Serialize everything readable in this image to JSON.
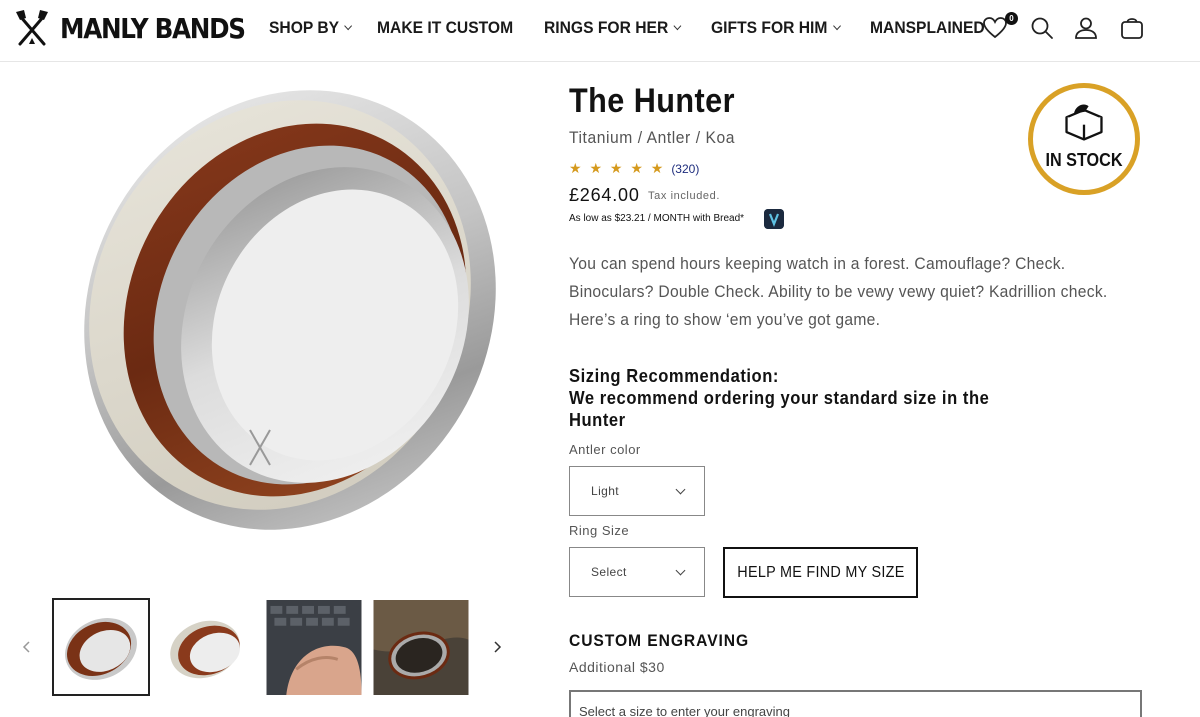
{
  "brand": {
    "name": "MANLY BANDS"
  },
  "nav": {
    "items": [
      {
        "label": "SHOP BY",
        "dropdown": true
      },
      {
        "label": "MAKE IT CUSTOM",
        "dropdown": false
      },
      {
        "label": "RINGS FOR HER",
        "dropdown": true
      },
      {
        "label": "GIFTS FOR HIM",
        "dropdown": true
      },
      {
        "label": "MANSPLAINED",
        "dropdown": false
      }
    ]
  },
  "header_icons": {
    "wishlist_icon": "heart-icon",
    "wishlist_count": "0",
    "search_icon": "search-icon",
    "account_icon": "user-icon",
    "cart_icon": "cart-icon"
  },
  "product": {
    "title": "The Hunter",
    "subtitle": "Titanium / Antler / Koa",
    "stars": "★ ★ ★ ★ ★",
    "rating_value": 5,
    "review_count": "(320)",
    "price": "£264.00",
    "tax_note": "Tax included.",
    "financing": "As low as $23.21 / MONTH with Bread*",
    "stock_badge": "IN STOCK",
    "description": "You can spend hours keeping watch in a forest. Camouflage? Check. Binoculars? Double Check. Ability to be vewy vewy quiet? Kadrillion check. Here’s a ring to show ‘em you’ve got game.",
    "sizing_heading": "Sizing Recommendation:",
    "sizing_text": "We recommend ordering your standard size in the Hunter"
  },
  "options": {
    "antler_label": "Antler color",
    "antler_value": "Light",
    "size_label": "Ring Size",
    "size_value": "Select",
    "help_button": "HELP ME FIND MY SIZE"
  },
  "engraving": {
    "title": "CUSTOM ENGRAVING",
    "subtitle": "Additional $30",
    "placeholder": "Select a size to enter your engraving"
  },
  "colors": {
    "text": "#121212",
    "muted": "#555555",
    "star": "#d59a1e",
    "badge_ring": "#d9a126",
    "link": "#1e2d7d"
  }
}
